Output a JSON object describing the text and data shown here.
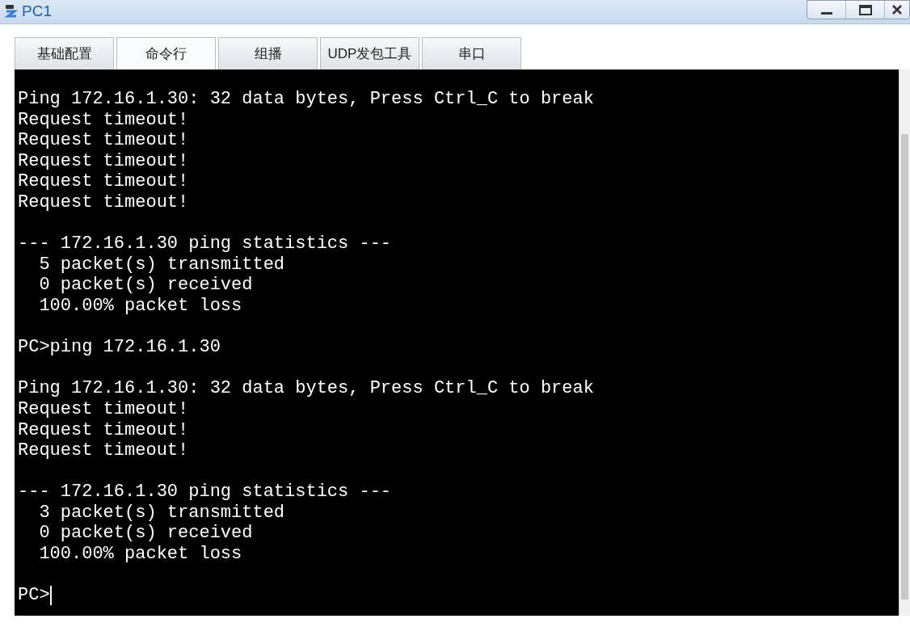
{
  "window": {
    "title": "PC1"
  },
  "tabs": [
    {
      "label": "基础配置",
      "selected": false
    },
    {
      "label": "命令行",
      "selected": true
    },
    {
      "label": "组播",
      "selected": false
    },
    {
      "label": "UDP发包工具",
      "selected": false
    },
    {
      "label": "串口",
      "selected": false
    }
  ],
  "terminal": {
    "blocks": [
      [
        "Ping 172.16.1.30: 32 data bytes, Press Ctrl_C to break",
        "Request timeout!",
        "Request timeout!",
        "Request timeout!",
        "Request timeout!",
        "Request timeout!"
      ],
      [
        "--- 172.16.1.30 ping statistics ---",
        "  5 packet(s) transmitted",
        "  0 packet(s) received",
        "  100.00% packet loss"
      ],
      [
        "PC>ping 172.16.1.30"
      ],
      [
        "Ping 172.16.1.30: 32 data bytes, Press Ctrl_C to break",
        "Request timeout!",
        "Request timeout!",
        "Request timeout!"
      ],
      [
        "--- 172.16.1.30 ping statistics ---",
        "  3 packet(s) transmitted",
        "  0 packet(s) received",
        "  100.00% packet loss"
      ]
    ],
    "prompt": "PC>",
    "cursor": true
  }
}
